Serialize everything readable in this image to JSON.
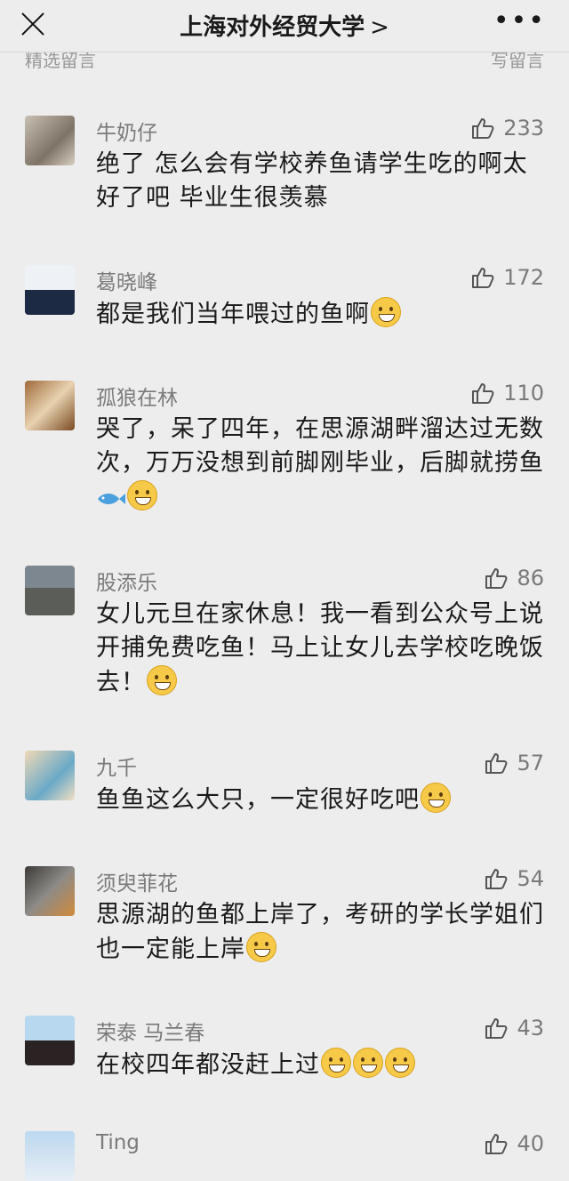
{
  "header": {
    "title": "上海对外经贸大学",
    "chevron": ">",
    "more": "•••"
  },
  "section": {
    "left": "精选留言",
    "right": "写留言"
  },
  "comments": [
    {
      "name": "牛奶仔",
      "likes": "233",
      "text": "绝了 怎么会有学校养鱼请学生吃的啊太好了吧 毕业生很羡慕",
      "emoji": []
    },
    {
      "name": "葛晓峰",
      "likes": "172",
      "text": "都是我们当年喂过的鱼啊",
      "emoji": [
        "crying-laugh"
      ]
    },
    {
      "name": "孤狼在林",
      "likes": "110",
      "text": "哭了，呆了四年，在思源湖畔溜达过无数次，万万没想到前脚刚毕业，后脚就捞鱼",
      "emoji": [
        "fish",
        "crying"
      ]
    },
    {
      "name": "股添乐",
      "likes": "86",
      "text": "女儿元旦在家休息！我一看到公众号上说开捕免费吃鱼！马上让女儿去学校吃晚饭去！",
      "emoji": [
        "grin"
      ]
    },
    {
      "name": "九千",
      "likes": "57",
      "text": "鱼鱼这么大只，一定很好吃吧",
      "emoji": [
        "doge"
      ]
    },
    {
      "name": "须臾菲花",
      "likes": "54",
      "text": "思源湖的鱼都上岸了，考研的学长学姐们也一定能上岸",
      "emoji": [
        "nerd"
      ]
    },
    {
      "name": "荣泰 马兰春",
      "likes": "43",
      "text": "在校四年都没赶上过",
      "emoji": [
        "tears-of-joy",
        "tears-of-joy",
        "tears-of-joy"
      ]
    },
    {
      "name": "Ting",
      "likes": "40",
      "text": "",
      "emoji": []
    }
  ],
  "colors": {
    "background": "#ededed",
    "name": "#7a7a7a",
    "text": "#1a1a1a"
  }
}
